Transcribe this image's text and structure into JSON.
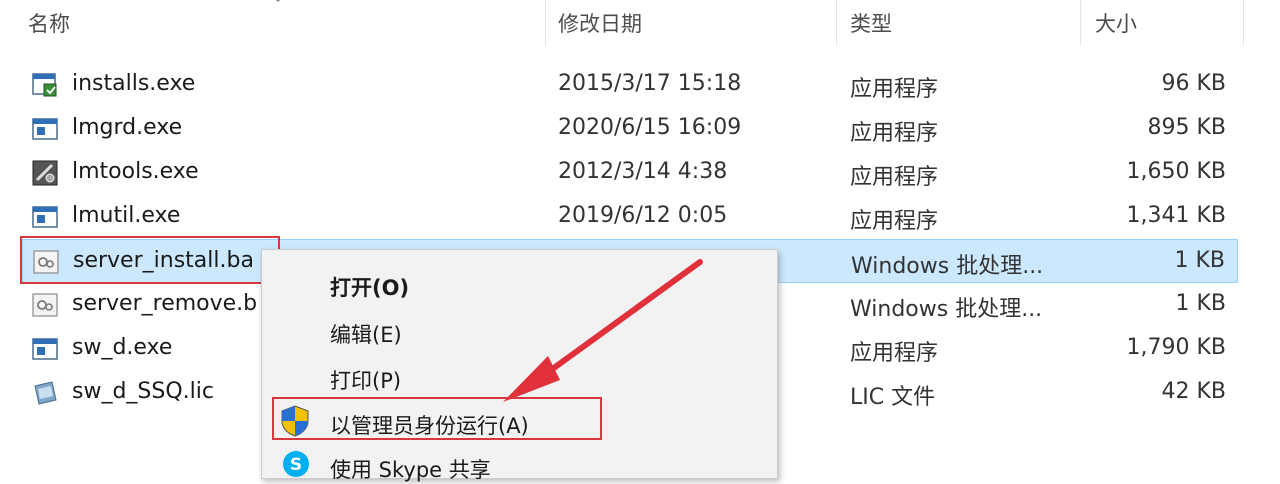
{
  "header": {
    "name": "名称",
    "date": "修改日期",
    "type": "类型",
    "size": "大小"
  },
  "files": [
    {
      "name": "installs.exe",
      "date": "2015/3/17 15:18",
      "type": "应用程序",
      "size": "96 KB",
      "icon": "exe-installer-icon"
    },
    {
      "name": "lmgrd.exe",
      "date": "2020/6/15 16:09",
      "type": "应用程序",
      "size": "895 KB",
      "icon": "exe-window-icon"
    },
    {
      "name": "lmtools.exe",
      "date": "2012/3/14 4:38",
      "type": "应用程序",
      "size": "1,650 KB",
      "icon": "exe-tools-icon"
    },
    {
      "name": "lmutil.exe",
      "date": "2019/6/12 0:05",
      "type": "应用程序",
      "size": "1,341 KB",
      "icon": "exe-window-icon"
    },
    {
      "name": "server_install.ba",
      "date": "",
      "type": "Windows 批处理...",
      "size": "1 KB",
      "icon": "batch-file-icon"
    },
    {
      "name": "server_remove.b",
      "date": "",
      "type": "Windows 批处理...",
      "size": "1 KB",
      "icon": "batch-file-icon"
    },
    {
      "name": "sw_d.exe",
      "date": "",
      "type": "应用程序",
      "size": "1,790 KB",
      "icon": "exe-window-icon"
    },
    {
      "name": "sw_d_SSQ.lic",
      "date": "",
      "type": "LIC 文件",
      "size": "42 KB",
      "icon": "lic-file-icon"
    }
  ],
  "context_menu": {
    "open": "打开(O)",
    "edit": "编辑(E)",
    "print": "打印(P)",
    "run_as_admin": "以管理员身份运行(A)",
    "skype_share": "使用 Skype 共享"
  },
  "colors": {
    "selection": "#cce8ff",
    "highlight": "#d9363e",
    "menu_bg": "#f2f2f2"
  }
}
